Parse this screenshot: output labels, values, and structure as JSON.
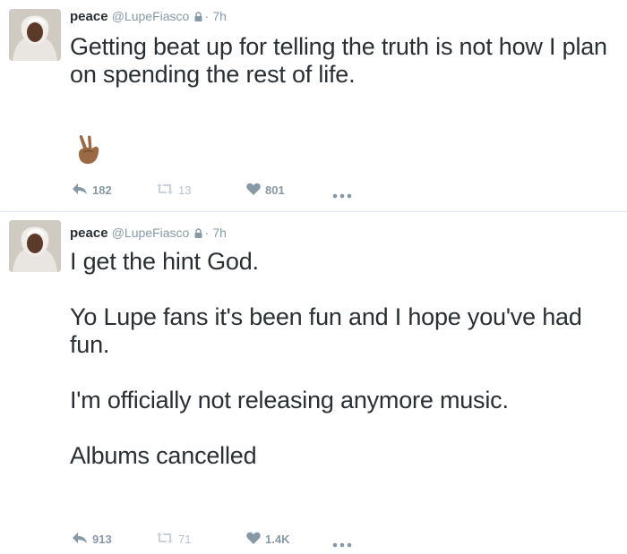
{
  "tweets": [
    {
      "author": {
        "name": "peace",
        "handle": "@LupeFiasco",
        "time": "7h"
      },
      "paragraphs": [
        "Getting beat up for telling the truth is not how I plan on spending the rest of life."
      ],
      "emoji": "victory-hand-medium-dark-skin",
      "actions": {
        "replies": "182",
        "retweets": "13",
        "likes": "801"
      }
    },
    {
      "author": {
        "name": "peace",
        "handle": "@LupeFiasco",
        "time": "7h"
      },
      "paragraphs": [
        "I get the hint God.",
        "",
        "Yo Lupe fans it's been fun and I hope you've had fun.",
        "",
        "I'm officially not releasing anymore music.",
        "",
        "Albums cancelled"
      ],
      "actions": {
        "replies": "913",
        "retweets": "71",
        "likes": "1.4K"
      }
    }
  ],
  "separator": "·",
  "colors": {
    "name": "#292f33",
    "meta": "#8899a6",
    "retweet_disabled": "#b7c3cc",
    "divider": "#e1e8ed"
  },
  "icons": [
    "lock-icon",
    "reply-icon",
    "retweet-icon",
    "heart-icon",
    "more-icon"
  ]
}
